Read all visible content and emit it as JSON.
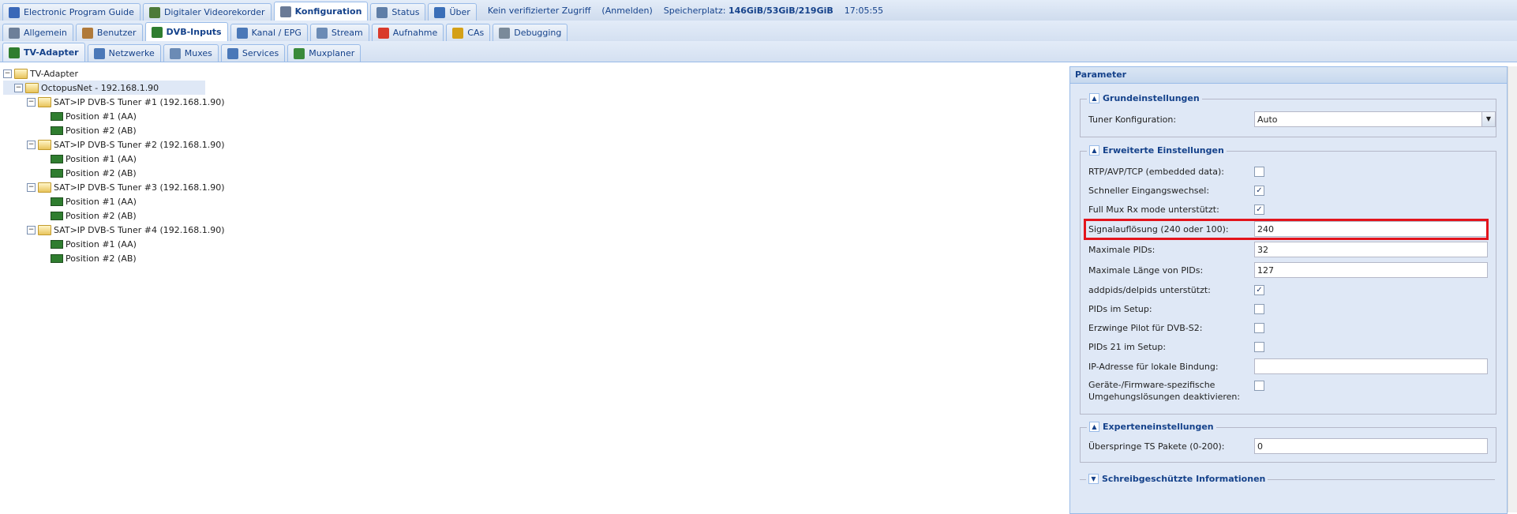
{
  "top_tabs": [
    {
      "label": "Electronic Program Guide",
      "icon": "epg-icon",
      "color": "#3a68b8"
    },
    {
      "label": "Digitaler Videorekorder",
      "icon": "download-icon",
      "color": "#4d7a3a"
    },
    {
      "label": "Konfiguration",
      "icon": "wrench-icon",
      "color": "#6a7a96",
      "active": true
    },
    {
      "label": "Status",
      "icon": "eye-icon",
      "color": "#5f7ea7"
    },
    {
      "label": "Über",
      "icon": "info-icon",
      "color": "#3b6fb8"
    }
  ],
  "status_info": {
    "access": "Kein verifizierter Zugriff",
    "login": "(Anmelden)",
    "storage_label": "Speicherplatz:",
    "storage_value": "146GiB/53GiB/219GiB",
    "time": "17:05:55"
  },
  "config_tabs": [
    {
      "label": "Allgemein",
      "icon": "tools-icon",
      "color": "#6d7f99"
    },
    {
      "label": "Benutzer",
      "icon": "users-icon",
      "color": "#b07a3a"
    },
    {
      "label": "DVB-Inputs",
      "icon": "dvb-card-icon",
      "color": "#2f7d2f",
      "active": true
    },
    {
      "label": "Kanal / EPG",
      "icon": "tv-icon",
      "color": "#4a78b8"
    },
    {
      "label": "Stream",
      "icon": "stream-icon",
      "color": "#6b8bb5"
    },
    {
      "label": "Aufnahme",
      "icon": "record-icon",
      "color": "#d93a2b"
    },
    {
      "label": "CAs",
      "icon": "key-icon",
      "color": "#d4a017"
    },
    {
      "label": "Debugging",
      "icon": "debug-icon",
      "color": "#7a8a9a"
    }
  ],
  "dvb_tabs": [
    {
      "label": "TV-Adapter",
      "icon": "dvb-card-icon",
      "color": "#2f7d2f",
      "active": true
    },
    {
      "label": "Netzwerke",
      "icon": "antenna-icon",
      "color": "#4a78b8"
    },
    {
      "label": "Muxes",
      "icon": "signal-icon",
      "color": "#6b8bb5"
    },
    {
      "label": "Services",
      "icon": "services-icon",
      "color": "#4a78b8"
    },
    {
      "label": "Muxplaner",
      "icon": "scheduler-icon",
      "color": "#3a8a3a"
    }
  ],
  "tree": {
    "root": "TV-Adapter",
    "device": "OctopusNet - 192.168.1.90",
    "tuners": [
      {
        "name": "SAT>IP DVB-S Tuner #1 (192.168.1.90)",
        "positions": [
          "Position #1 (AA)",
          "Position #2 (AB)"
        ]
      },
      {
        "name": "SAT>IP DVB-S Tuner #2 (192.168.1.90)",
        "positions": [
          "Position #1 (AA)",
          "Position #2 (AB)"
        ]
      },
      {
        "name": "SAT>IP DVB-S Tuner #3 (192.168.1.90)",
        "positions": [
          "Position #1 (AA)",
          "Position #2 (AB)"
        ]
      },
      {
        "name": "SAT>IP DVB-S Tuner #4 (192.168.1.90)",
        "positions": [
          "Position #1 (AA)",
          "Position #2 (AB)"
        ]
      }
    ]
  },
  "panel": {
    "title": "Parameter",
    "grund": {
      "legend": "Grundeinstellungen",
      "tuner_label": "Tuner Konfiguration:",
      "tuner_value": "Auto"
    },
    "erweitert": {
      "legend": "Erweiterte Einstellungen",
      "rtp_label": "RTP/AVP/TCP (embedded data):",
      "rtp_checked": false,
      "fast_label": "Schneller Eingangswechsel:",
      "fast_checked": true,
      "fullmux_label": "Full Mux Rx mode unterstützt:",
      "fullmux_checked": true,
      "signal_label": "Signalauflösung (240 oder 100):",
      "signal_value": "240",
      "maxpids_label": "Maximale PIDs:",
      "maxpids_value": "32",
      "maxlen_label": "Maximale Länge von PIDs:",
      "maxlen_value": "127",
      "addpids_label": "addpids/delpids unterstützt:",
      "addpids_checked": true,
      "pidsetup_label": "PIDs im Setup:",
      "pidsetup_checked": false,
      "pilot_label": "Erzwinge Pilot für DVB-S2:",
      "pilot_checked": false,
      "pids21_label": "PIDs 21 im Setup:",
      "pids21_checked": false,
      "ip_label": "IP-Adresse für lokale Bindung:",
      "ip_value": "",
      "workaround_label1": "Geräte-/Firmware-spezifische",
      "workaround_label2": "Umgehungslösungen deaktivieren:",
      "workaround_checked": false
    },
    "experten": {
      "legend": "Experteneinstellungen",
      "skip_label": "Überspringe TS Pakete (0-200):",
      "skip_value": "0"
    },
    "readonly_legend": "Schreibgeschützte Informationen"
  }
}
